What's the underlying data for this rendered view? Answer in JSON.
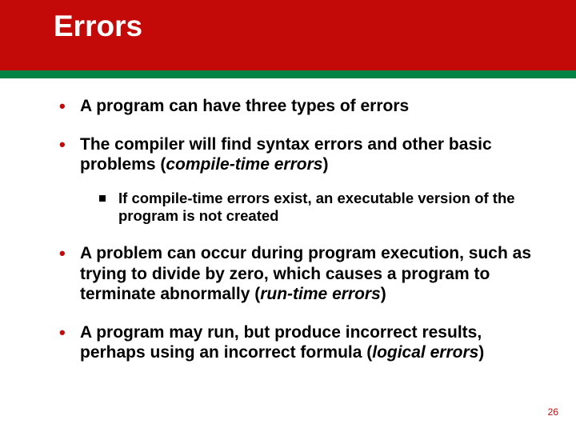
{
  "slide": {
    "title": "Errors",
    "page_number": "26",
    "bullets": [
      {
        "text": "A program can have three types of errors",
        "sub": []
      },
      {
        "parts": [
          {
            "t": "The compiler will find syntax errors and other basic problems (",
            "i": false
          },
          {
            "t": "compile-time errors",
            "i": true
          },
          {
            "t": ")",
            "i": false
          }
        ],
        "sub": [
          {
            "text": "If compile-time errors exist, an executable version of the program is not created"
          }
        ]
      },
      {
        "parts": [
          {
            "t": "A problem can occur during program execution, such as trying to divide by zero, which causes a program to terminate abnormally (",
            "i": false
          },
          {
            "t": "run-time errors",
            "i": true
          },
          {
            "t": ")",
            "i": false
          }
        ],
        "sub": []
      },
      {
        "parts": [
          {
            "t": "A program may run, but produce incorrect results, perhaps using an incorrect formula (",
            "i": false
          },
          {
            "t": "logical errors",
            "i": true
          },
          {
            "t": ")",
            "i": false
          }
        ],
        "sub": []
      }
    ]
  }
}
